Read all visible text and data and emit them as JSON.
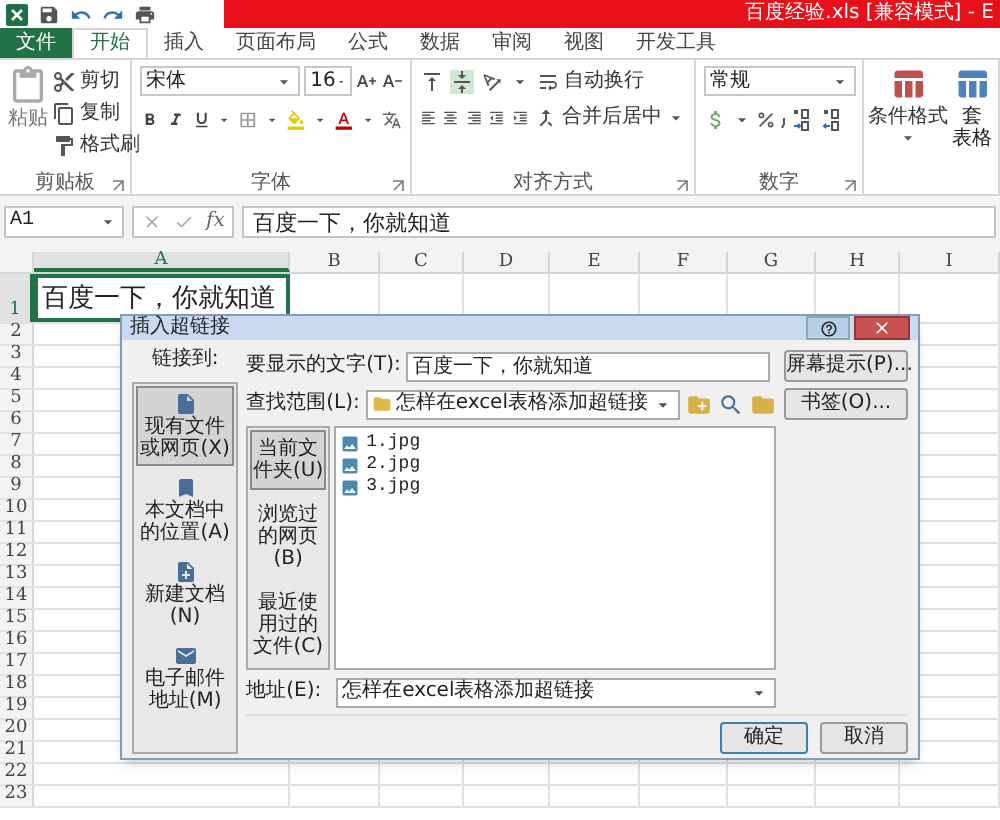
{
  "title_bar": {
    "file_title": "百度经验.xls  [兼容模式]  -  E"
  },
  "ribbon_tabs": [
    {
      "label": "文件",
      "kind": "file",
      "selected": false
    },
    {
      "label": "开始",
      "kind": "tab",
      "selected": true
    },
    {
      "label": "插入",
      "kind": "tab",
      "selected": false
    },
    {
      "label": "页面布局",
      "kind": "tab",
      "selected": false
    },
    {
      "label": "公式",
      "kind": "tab",
      "selected": false
    },
    {
      "label": "数据",
      "kind": "tab",
      "selected": false
    },
    {
      "label": "审阅",
      "kind": "tab",
      "selected": false
    },
    {
      "label": "视图",
      "kind": "tab",
      "selected": false
    },
    {
      "label": "开发工具",
      "kind": "tab",
      "selected": false
    }
  ],
  "ribbon": {
    "clipboard": {
      "paste": "粘贴",
      "cut": "剪切",
      "copy": "复制",
      "format_painter": "格式刷",
      "label": "剪贴板"
    },
    "font": {
      "font_name": "宋体",
      "font_size": "16",
      "label": "字体"
    },
    "alignment": {
      "wrap_text": "自动换行",
      "merge_center": "合并后居中",
      "label": "对齐方式"
    },
    "number": {
      "format": "常规",
      "label": "数字"
    },
    "styles": {
      "conditional_formatting": "条件格式",
      "format_as_table_top": "套",
      "format_as_table_bottom": "表格"
    }
  },
  "formula_bar": {
    "name_box": "A1",
    "function_button": "fx",
    "formula": "百度一下，你就知道"
  },
  "sheet": {
    "columns": [
      {
        "label": "A",
        "selected": true
      },
      {
        "label": "B",
        "selected": false
      },
      {
        "label": "C",
        "selected": false
      },
      {
        "label": "D",
        "selected": false
      },
      {
        "label": "E",
        "selected": false
      },
      {
        "label": "F",
        "selected": false
      },
      {
        "label": "G",
        "selected": false
      },
      {
        "label": "H",
        "selected": false
      },
      {
        "label": "I",
        "selected": false
      }
    ],
    "rows": [
      {
        "label": "1",
        "selected": true
      },
      {
        "label": "2",
        "selected": false
      },
      {
        "label": "3",
        "selected": false
      },
      {
        "label": "4",
        "selected": false
      },
      {
        "label": "5",
        "selected": false
      },
      {
        "label": "6",
        "selected": false
      },
      {
        "label": "7",
        "selected": false
      },
      {
        "label": "8",
        "selected": false
      },
      {
        "label": "9",
        "selected": false
      },
      {
        "label": "10",
        "selected": false
      },
      {
        "label": "11",
        "selected": false
      },
      {
        "label": "12",
        "selected": false
      },
      {
        "label": "13",
        "selected": false
      },
      {
        "label": "14",
        "selected": false
      },
      {
        "label": "15",
        "selected": false
      },
      {
        "label": "16",
        "selected": false
      },
      {
        "label": "17",
        "selected": false
      },
      {
        "label": "18",
        "selected": false
      },
      {
        "label": "19",
        "selected": false
      },
      {
        "label": "20",
        "selected": false
      },
      {
        "label": "21",
        "selected": false
      },
      {
        "label": "22",
        "selected": false
      },
      {
        "label": "23",
        "selected": false
      }
    ],
    "cell_a1": "百度一下，你就知道"
  },
  "dialog": {
    "title": "插入超链接",
    "link_to_label": "链接到:",
    "link_types": [
      {
        "label": "现有文件或网页(X)",
        "kind": "file",
        "selected": true
      },
      {
        "label": "本文档中的位置(A)",
        "kind": "place",
        "selected": false
      },
      {
        "label": "新建文档(N)",
        "kind": "new",
        "selected": false
      },
      {
        "label": "电子邮件地址(M)",
        "kind": "email",
        "selected": false
      }
    ],
    "display_text_label": "要显示的文字(T):",
    "display_text": "百度一下，你就知道",
    "screentip_button": "屏幕提示(P)...",
    "look_in_label": "查找范围(L):",
    "look_in": "怎样在excel表格添加超链接",
    "bookmark_button": "书签(O)...",
    "sources": [
      {
        "label": "当前文件夹(U)",
        "selected": true
      },
      {
        "label": "浏览过的网页(B)",
        "selected": false
      },
      {
        "label": "最近使用过的文件(C)",
        "selected": false
      }
    ],
    "files": [
      "1.jpg",
      "2.jpg",
      "3.jpg"
    ],
    "address_label": "地址(E):",
    "address": "怎样在excel表格添加超链接",
    "ok_button": "确定",
    "cancel_button": "取消"
  }
}
